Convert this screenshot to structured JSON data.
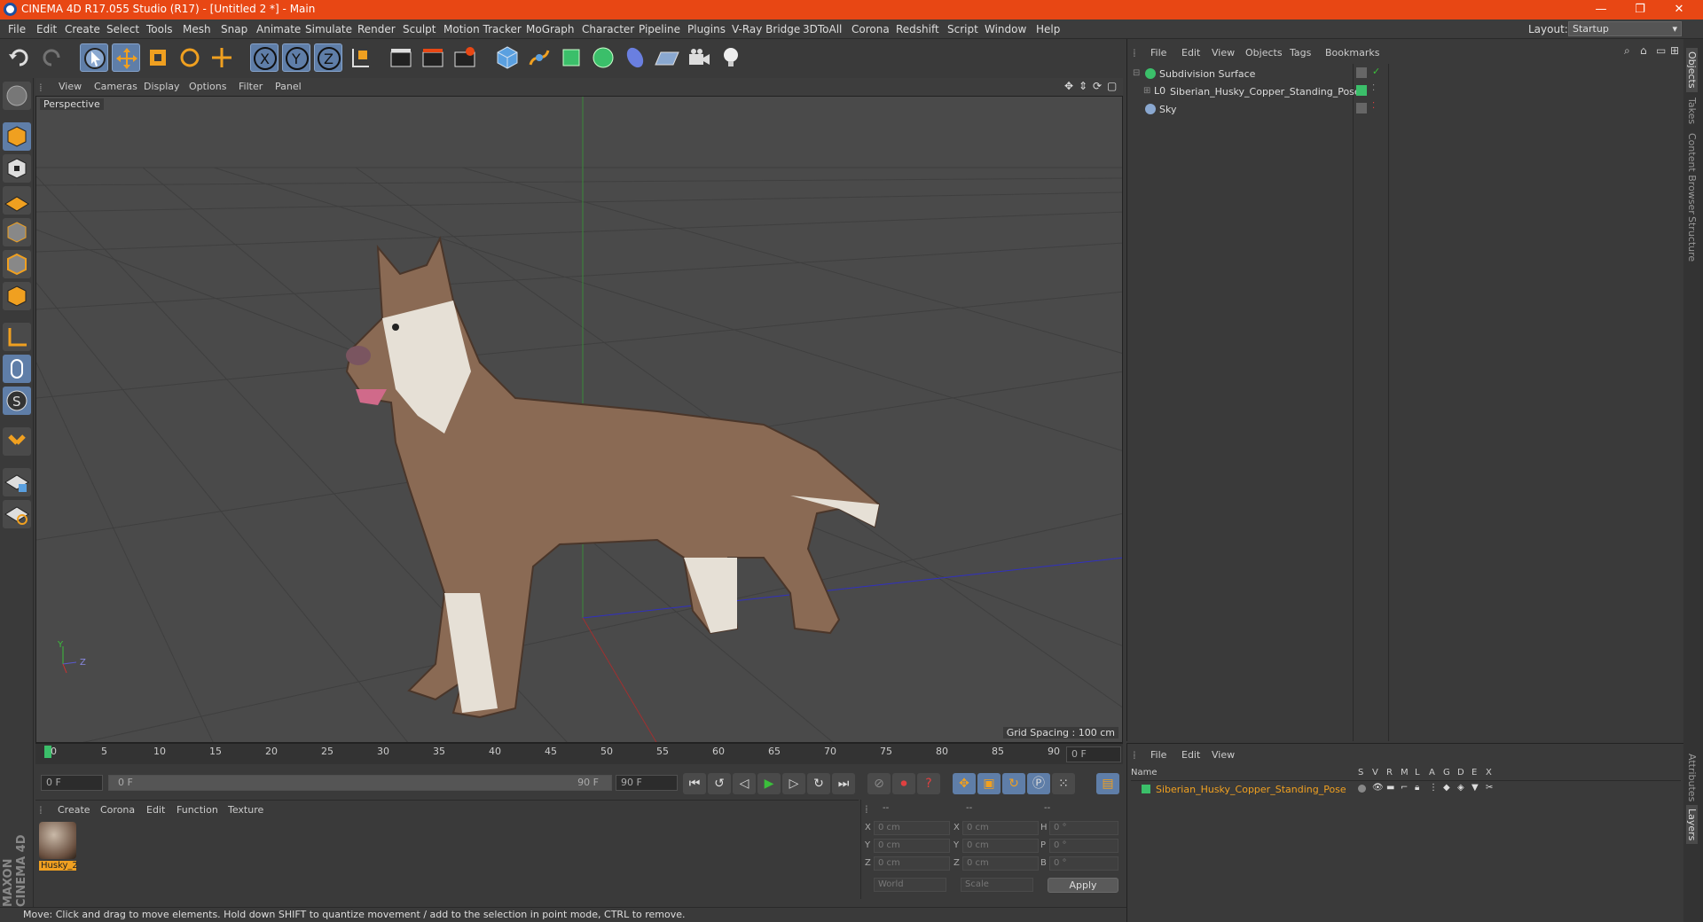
{
  "window": {
    "title": "CINEMA 4D R17.055 Studio (R17) - [Untitled 2 *] - Main"
  },
  "menu": [
    "File",
    "Edit",
    "Create",
    "Select",
    "Tools",
    "Mesh",
    "Snap",
    "Animate",
    "Simulate",
    "Render",
    "Sculpt",
    "Motion Tracker",
    "MoGraph",
    "Character",
    "Pipeline",
    "Plugins",
    "V-Ray Bridge",
    "3DToAll",
    "Corona",
    "Redshift",
    "Script",
    "Window",
    "Help"
  ],
  "layout": {
    "label": "Layout:",
    "value": "Startup"
  },
  "viewport": {
    "menu": [
      "View",
      "Cameras",
      "Display",
      "Options",
      "Filter",
      "Panel"
    ],
    "label": "Perspective",
    "grid_spacing": "Grid Spacing : 100 cm",
    "axis": {
      "y": "Y",
      "z": "Z"
    }
  },
  "timeline": {
    "ticks": [
      "0",
      "5",
      "10",
      "15",
      "20",
      "25",
      "30",
      "35",
      "40",
      "45",
      "50",
      "55",
      "60",
      "65",
      "70",
      "75",
      "80",
      "85",
      "90"
    ],
    "current_frame": "0 F",
    "start": "0 F",
    "range_start": "0 F",
    "range_end": "90 F",
    "end": "90 F"
  },
  "material": {
    "menu": [
      "Create",
      "Corona",
      "Edit",
      "Function",
      "Texture"
    ],
    "name": "Husky_2"
  },
  "coords": {
    "headers": [
      "--",
      "--",
      "--"
    ],
    "rows": [
      {
        "l1": "X",
        "v1": "0 cm",
        "l2": "X",
        "v2": "0 cm",
        "l3": "H",
        "v3": "0 °"
      },
      {
        "l1": "Y",
        "v1": "0 cm",
        "l2": "Y",
        "v2": "0 cm",
        "l3": "P",
        "v3": "0 °"
      },
      {
        "l1": "Z",
        "v1": "0 cm",
        "l2": "Z",
        "v2": "0 cm",
        "l3": "B",
        "v3": "0 °"
      }
    ],
    "world": "World",
    "scale": "Scale",
    "apply": "Apply"
  },
  "objects": {
    "menu": [
      "File",
      "Edit",
      "View",
      "Objects",
      "Tags",
      "Bookmarks"
    ],
    "items": [
      {
        "name": "Subdivision Surface"
      },
      {
        "name": "Siberian_Husky_Copper_Standing_Pose"
      },
      {
        "name": "Sky"
      }
    ]
  },
  "layers": {
    "menu": [
      "File",
      "Edit",
      "View"
    ],
    "col_name": "Name",
    "cols": [
      "S",
      "V",
      "R",
      "M",
      "L",
      "A",
      "G",
      "D",
      "E",
      "X"
    ],
    "items": [
      {
        "name": "Siberian_Husky_Copper_Standing_Pose"
      }
    ]
  },
  "right_tabs": [
    "Objects",
    "Takes",
    "Content Browser",
    "Structure",
    "Attributes",
    "Layers"
  ],
  "brand": "MAXON CINEMA 4D",
  "status": "Move: Click and drag to move elements. Hold down SHIFT to quantize movement / add to the selection in point mode, CTRL to remove."
}
